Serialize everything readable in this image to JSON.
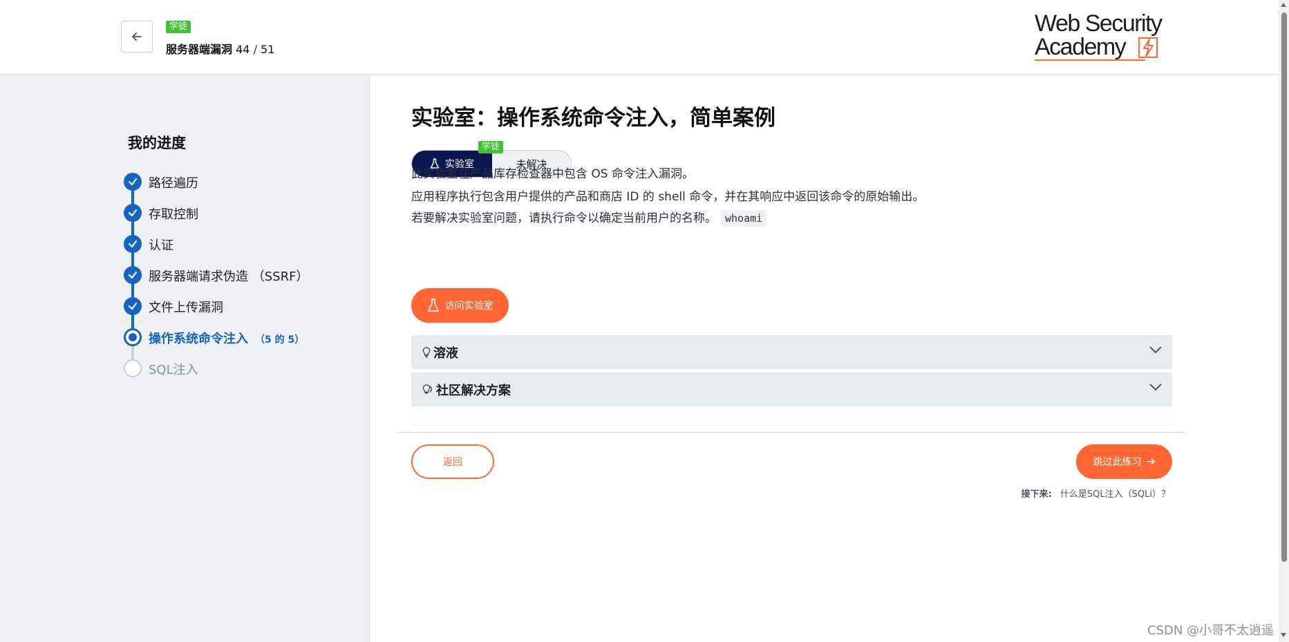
{
  "header": {
    "badge": "学徒",
    "crumb_title": "服务器端漏洞",
    "crumb_current": "44",
    "crumb_sep": "/",
    "crumb_total": "51",
    "logo_line1": "Web Security",
    "logo_line2": "Academy"
  },
  "sidebar": {
    "title": "我的进度",
    "steps": [
      {
        "label": "路径遍历",
        "state": "done"
      },
      {
        "label": "存取控制",
        "state": "done"
      },
      {
        "label": "认证",
        "state": "done"
      },
      {
        "label": "服务器端请求伪造 （SSRF）",
        "state": "done"
      },
      {
        "label": "文件上传漏洞",
        "state": "done"
      },
      {
        "label": "操作系统命令注入",
        "state": "current",
        "count": "（5 的 5）"
      },
      {
        "label": "SQL注入",
        "state": "todo"
      }
    ]
  },
  "main": {
    "title": "实验室：操作系统命令注入，简单案例",
    "pill_lab": "实验室",
    "pill_badge": "学徒",
    "pill_status": "未解决",
    "desc1": "此实验室在产品库存检查器中包含 OS 命令注入漏洞。",
    "desc2": "应用程序执行包含用户提供的产品和商店 ID 的 shell 命令，并在其响应中返回该命令的原始输出。",
    "desc3": "若要解决实验室问题，请执行命令以确定当前用户的名称。",
    "desc3_code": "whoami",
    "access_button": "访问实验室",
    "accordion_solution": "溶液",
    "accordion_community": "社区解决方案",
    "return_button": "返回",
    "skip_button": "跳过此练习",
    "next_label": "接下来:",
    "next_link": "什么是SQL注入（SQLi）？"
  },
  "watermark": "CSDN @小哥不太逍遥",
  "colors": {
    "accent": "#ff6633",
    "primary_blue": "#1565c0",
    "navy": "#0a1650",
    "badge_green": "#3cc32f",
    "sidebar_bg": "#eef0f3"
  }
}
